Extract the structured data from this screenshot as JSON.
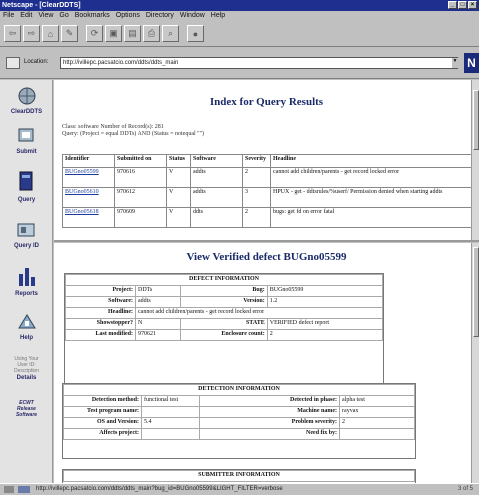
{
  "window": {
    "title": "Netscape - [ClearDDTS]"
  },
  "menu": [
    "File",
    "Edit",
    "View",
    "Go",
    "Bookmarks",
    "Options",
    "Directory",
    "Window",
    "Help"
  ],
  "location": {
    "label": "Location:",
    "url": "http://ivillepc.pacsatcio.com/ddts/ddts_main"
  },
  "sidebar": {
    "logo": "ClearDDTS",
    "items": [
      "Submit",
      "Query",
      "Query ID",
      "Reports",
      "Help"
    ],
    "faint": [
      "Using Your",
      "User ID:",
      "Description"
    ],
    "details": "Details",
    "small": [
      "ECWT",
      "Release",
      "Software"
    ]
  },
  "query": {
    "title": "Index for Query Results",
    "meta_line1": "Class: software     Number of Record(s): 281",
    "meta_line2": "Query: (Project = equal DDTs) AND (Status = notequal \"\")",
    "columns": [
      "Identifier",
      "Submitted on",
      "Status",
      "Software",
      "Severity",
      "Headline"
    ],
    "rows": [
      [
        "BUGno05599",
        "970616",
        "V",
        "addts",
        "2",
        "cannot add children/parents - get record locked error"
      ],
      [
        "BUGno05610",
        "970612",
        "V",
        "addts",
        "3",
        "HPUX - get - ddtsrules/%userf/ Permission denied when starting addts"
      ],
      [
        "BUGno05618",
        "970609",
        "V",
        "ddts",
        "2",
        "bugs: get fd on error fatal"
      ]
    ]
  },
  "defect": {
    "title": "View Verified defect BUGno05599",
    "info_header": "DEFECT INFORMATION",
    "project_label": "Project:",
    "project": "DDTs",
    "bug_label": "Bug:",
    "bug": "BUGno05599",
    "software_label": "Software:",
    "software": "addts",
    "version_label": "Version:",
    "version": "1.2",
    "headline_label": "Headline:",
    "headline": "cannot add children/parents - get record locked error",
    "showstopper_label": "Showstopper?",
    "showstopper": "N",
    "state_label": "STATE",
    "state": "VERIFIED defect report",
    "last_modified_label": "Last modified:",
    "last_modified": "970621",
    "enclosure_label": "Enclosure count:",
    "enclosure": "2"
  },
  "detection": {
    "header": "DETECTION INFORMATION",
    "method_label": "Detection method:",
    "method": "functional test",
    "phase_label": "Detected in phase:",
    "phase": "alpha test",
    "test_program_label": "Test program name:",
    "test_program": "",
    "machine_label": "Machine name:",
    "machine": "rayvax",
    "os_label": "OS and Version:",
    "os": "5.4",
    "severity_label": "Problem severity:",
    "severity": "2",
    "affects_label": "Affects project:",
    "affects": "",
    "fix_label": "Need fix by:",
    "fix": ""
  },
  "submitter": {
    "header": "SUBMITTER INFORMATION"
  },
  "status_bar": {
    "text": "http://ivillepc.pacsatcio.com/ddts/ddts_main?bug_id=BUGno05599&LIGHT_FILTER=verbose",
    "right": "3 of 5"
  }
}
